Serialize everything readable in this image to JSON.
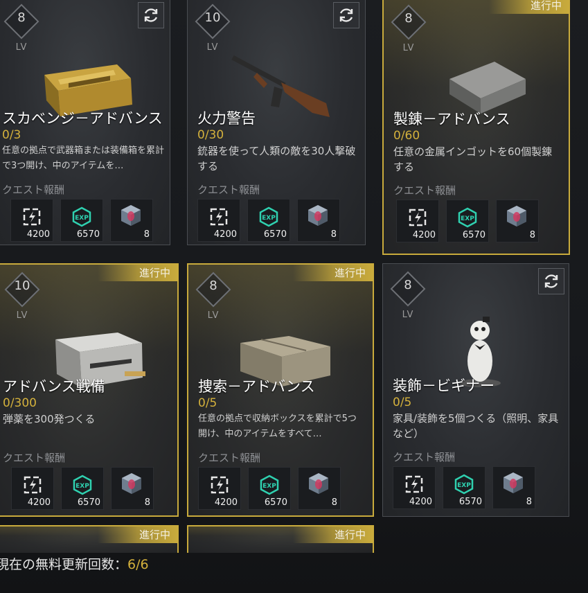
{
  "cards": [
    {
      "level": "8",
      "lv_label": "LV",
      "title": "スカベンジ－アドバンス",
      "progress": "0/3",
      "desc": "任意の拠点で武器箱または装備箱を累計で3つ開け、中のアイテムを…",
      "reward_label": "クエスト報酬",
      "status": "",
      "rewards": {
        "supply": "4200",
        "exp": "6570",
        "cube": "8"
      }
    },
    {
      "level": "10",
      "lv_label": "LV",
      "title": "火力警告",
      "progress": "0/30",
      "desc": "銃器を使って人類の敵を30人撃破する",
      "reward_label": "クエスト報酬",
      "status": "",
      "rewards": {
        "supply": "4200",
        "exp": "6570",
        "cube": "8"
      }
    },
    {
      "level": "8",
      "lv_label": "LV",
      "title": "製錬－アドバンス",
      "progress": "0/60",
      "desc": "任意の金属インゴットを60個製錬する",
      "reward_label": "クエスト報酬",
      "status": "進行中",
      "rewards": {
        "supply": "4200",
        "exp": "6570",
        "cube": "8"
      }
    },
    {
      "level": "10",
      "lv_label": "LV",
      "title": "アドバンス戦備",
      "progress": "0/300",
      "desc": "弾薬を300発つくる",
      "reward_label": "クエスト報酬",
      "status": "進行中",
      "rewards": {
        "supply": "4200",
        "exp": "6570",
        "cube": "8"
      }
    },
    {
      "level": "8",
      "lv_label": "LV",
      "title": "捜索－アドバンス",
      "progress": "0/5",
      "desc": "任意の拠点で収納ボックスを累計で5つ開け、中のアイテムをすべて…",
      "reward_label": "クエスト報酬",
      "status": "進行中",
      "rewards": {
        "supply": "4200",
        "exp": "6570",
        "cube": "8"
      }
    },
    {
      "level": "8",
      "lv_label": "LV",
      "title": "装飾－ビギナー",
      "progress": "0/5",
      "desc": "家具/装飾を5個つくる（照明、家具など）",
      "reward_label": "クエスト報酬",
      "status": "",
      "rewards": {
        "supply": "4200",
        "exp": "6570",
        "cube": "8"
      }
    }
  ],
  "partial_tags": [
    "進行中",
    "進行中"
  ],
  "footer": {
    "label": "現在の無料更新回数：",
    "value": "6/6"
  },
  "icons": {
    "refresh": "refresh-icon",
    "supply": "supply-icon",
    "exp": "exp-icon",
    "cube": "cube-icon"
  },
  "colors": {
    "accent": "#c9ab3c",
    "progress": "#d4b13c",
    "exp": "#2fd1b0"
  }
}
